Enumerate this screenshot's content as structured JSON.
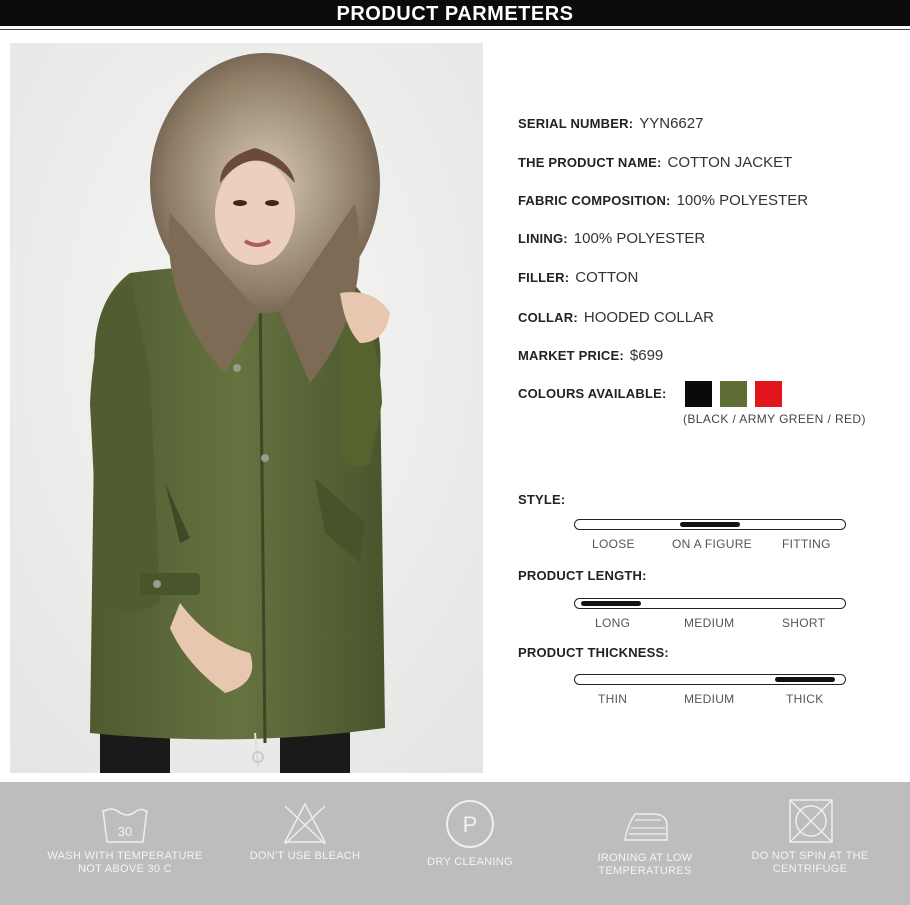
{
  "header": {
    "title": "PRODUCT PARMETERS"
  },
  "params": {
    "serial": {
      "label": "SERIAL NUMBER:",
      "value": "YYN6627"
    },
    "product_name": {
      "label": "THE PRODUCT NAME:",
      "value": "COTTON JACKET"
    },
    "fabric": {
      "label": "FABRIC COMPOSITION:",
      "value": "100% POLYESTER"
    },
    "lining": {
      "label": "LINING:",
      "value": "100% POLYESTER"
    },
    "filler": {
      "label": "FILLER:",
      "value": "COTTON"
    },
    "collar": {
      "label": "COLLAR:",
      "value": "HOODED COLLAR"
    },
    "price": {
      "label": "MARKET PRICE:",
      "value": "$699"
    },
    "colours": {
      "label": "COLOURS AVAILABLE:",
      "note": "(BLACK / ARMY GREEN / RED)",
      "swatches": [
        "#0a0a0a",
        "#5f6d37",
        "#e3151c"
      ]
    }
  },
  "scales": {
    "style": {
      "label": "STYLE:",
      "ticks": [
        "LOOSE",
        "ON A FIGURE",
        "FITTING"
      ],
      "selected": "ON A FIGURE",
      "position": 0.5
    },
    "length": {
      "label": "PRODUCT LENGTH:",
      "ticks": [
        "LONG",
        "MEDIUM",
        "SHORT"
      ],
      "selected": "LONG",
      "position": 0.12
    },
    "thickness": {
      "label": "PRODUCT THICKNESS:",
      "ticks": [
        "THIN",
        "MEDIUM",
        "THICK"
      ],
      "selected": "THICK",
      "position": 0.85
    }
  },
  "care": [
    {
      "icon": "wash-30-icon",
      "label": "WASH WITH TEMPERATURE NOT ABOVE 30 C",
      "wash_temp": "30"
    },
    {
      "icon": "no-bleach-icon",
      "label": "DON'T USE BLEACH"
    },
    {
      "icon": "dry-clean-icon",
      "label": "DRY CLEANING",
      "letter": "P"
    },
    {
      "icon": "iron-low-icon",
      "label": "IRONING AT LOW TEMPERATURES"
    },
    {
      "icon": "no-spin-icon",
      "label": "DO NOT SPIN AT THE CENTRIFUGE"
    }
  ],
  "colors": {
    "header_bg": "#0b0b0b",
    "care_bg": "#bdbdbd",
    "jacket": "#5c6a3a"
  }
}
